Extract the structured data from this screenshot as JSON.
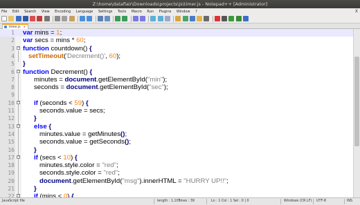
{
  "window": {
    "title": "Z:\\home\\dataflair\\Downloads\\projects\\js\\timer.js - Notepad++ [Administrator]"
  },
  "menu": {
    "items": [
      "File",
      "Edit",
      "Search",
      "View",
      "Encoding",
      "Language",
      "Settings",
      "Tools",
      "Macro",
      "Run",
      "Plugins",
      "Window",
      "?"
    ],
    "close_glyph": "X"
  },
  "toolbar": {
    "icons": [
      "new-file-icon",
      "open-file-icon",
      "save-icon",
      "save-all-icon",
      "close-icon",
      "close-all-icon",
      "print-icon",
      "cut-icon",
      "copy-icon",
      "paste-icon",
      "undo-icon",
      "redo-icon",
      "find-icon",
      "replace-icon",
      "zoom-in-icon",
      "zoom-out-icon",
      "sync-v-icon",
      "sync-h-icon",
      "word-wrap-icon",
      "all-chars-icon",
      "indent-guide-icon",
      "udl-icon",
      "doc-map-icon",
      "function-list-icon",
      "folder-workspace-icon",
      "monitor-icon",
      "record-macro-icon",
      "stop-macro-icon",
      "play-macro-icon",
      "run-macro-multi-icon",
      "save-macro-icon"
    ]
  },
  "tab": {
    "label": "timer.js",
    "close_glyph": "x"
  },
  "editor": {
    "line_numbers": [
      "1",
      "2",
      "3",
      "4",
      "5",
      "6",
      "7",
      "8",
      "9",
      "10",
      "11",
      "12",
      "13",
      "14",
      "15",
      "16",
      "17",
      "18",
      "19",
      "20",
      "21",
      "22"
    ],
    "current_line": 1
  },
  "status": {
    "file_type": "JavaScript file",
    "length": "length : 1,105",
    "lines": "lines : 39",
    "position": "Ln : 1    Col : 1    Sel : 0 | 0",
    "eol": "Windows (CR LF)",
    "encoding": "UTF-8",
    "mode": "INS"
  },
  "colors": {
    "keyword": "#0000ff",
    "string": "#808080",
    "number": "#ff8000",
    "object": "#000080",
    "current_line_bg": "#e8e8ff",
    "tab_accent": "#f5a623"
  }
}
